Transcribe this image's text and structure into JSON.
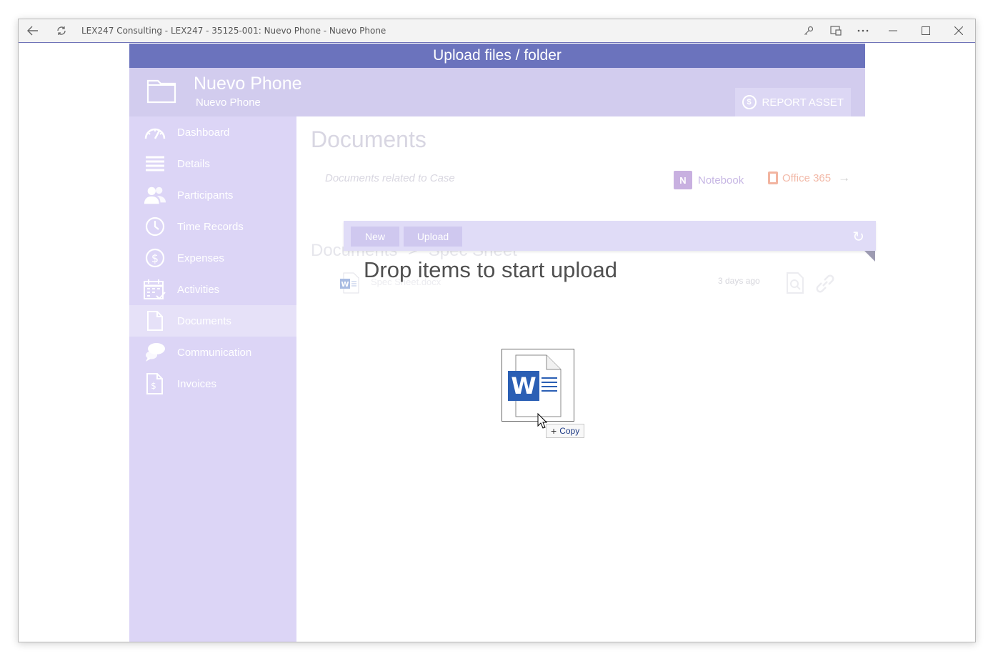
{
  "window": {
    "title": "LEX247 Consulting - LEX247 - 35125-001: Nuevo Phone - Nuevo Phone"
  },
  "upload_bar": {
    "title": "Upload files / folder"
  },
  "header": {
    "title": "Nuevo Phone",
    "subtitle": "Nuevo Phone",
    "report_label": "REPORT ASSET"
  },
  "sidebar": {
    "items": [
      {
        "label": "Dashboard",
        "icon": "gauge-icon"
      },
      {
        "label": "Details",
        "icon": "list-icon"
      },
      {
        "label": "Participants",
        "icon": "people-icon"
      },
      {
        "label": "Time Records",
        "icon": "clock-icon"
      },
      {
        "label": "Expenses",
        "icon": "dollar-icon"
      },
      {
        "label": "Activities",
        "icon": "calendar-icon"
      },
      {
        "label": "Documents",
        "icon": "document-icon",
        "active": true
      },
      {
        "label": "Communication",
        "icon": "chat-icon"
      },
      {
        "label": "Invoices",
        "icon": "invoice-icon"
      }
    ]
  },
  "main": {
    "title": "Documents",
    "related": "Documents related to Case",
    "notebook_label": "Notebook",
    "office_label": "Office 365",
    "toolbar": {
      "new_label": "New",
      "upload_label": "Upload"
    },
    "breadcrumb": {
      "root": "Documents",
      "sep": ">",
      "current": "Spec Sheet"
    },
    "files": [
      {
        "name": "Spec Sheet.docx",
        "date": "3 days ago"
      }
    ]
  },
  "drop": {
    "message": "Drop items to start upload",
    "copy_label": "Copy"
  },
  "colors": {
    "accent": "#6b73bd",
    "sidebar": "#dcd5f6",
    "header": "#d2ccee",
    "word": "#2b5fb4"
  }
}
